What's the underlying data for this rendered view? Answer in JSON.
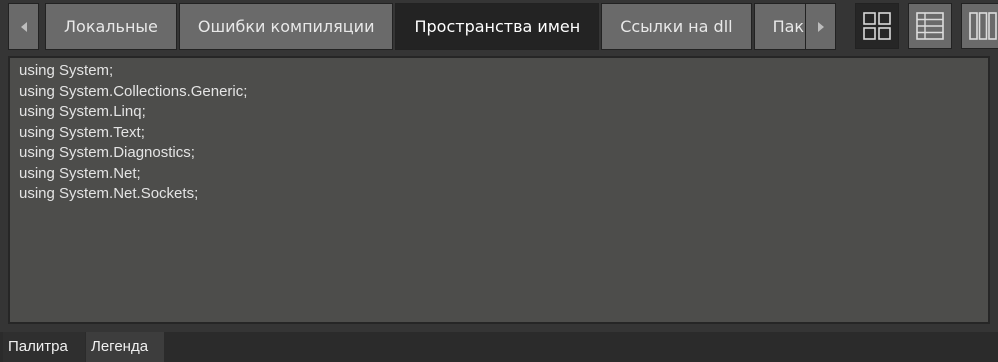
{
  "tabs": [
    {
      "label": "Локальные",
      "active": false
    },
    {
      "label": "Ошибки компиляции",
      "active": false
    },
    {
      "label": "Пространства имен",
      "active": true
    },
    {
      "label": "Ссылки на dll",
      "active": false
    },
    {
      "label": "Пакеты",
      "active": false
    }
  ],
  "view_buttons": [
    {
      "icon": "grid-four-icon",
      "active": true
    },
    {
      "icon": "table-rows-icon",
      "active": false
    },
    {
      "icon": "columns-icon",
      "active": false
    }
  ],
  "editor": {
    "lines": [
      "using System;",
      "using System.Collections.Generic;",
      "using System.Linq;",
      "using System.Text;",
      "using System.Diagnostics;",
      "using System.Net;",
      "using System.Net.Sockets;"
    ]
  },
  "bottom_tabs": {
    "palette": "Палитра",
    "legend": "Легенда"
  },
  "colors": {
    "tab_bg": "#6a6a6a",
    "tab_active_bg": "#232323",
    "editor_bg": "#4d4d4b"
  }
}
